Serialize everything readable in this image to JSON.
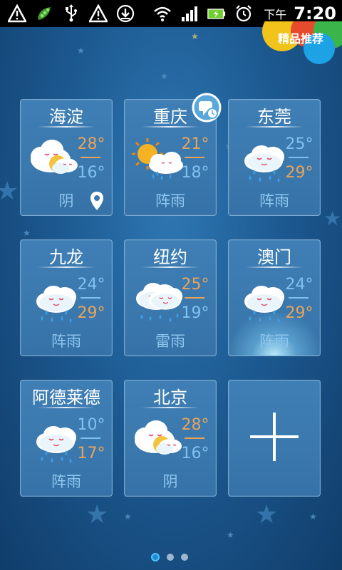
{
  "status_bar": {
    "ampm": "下午",
    "time": "7:20",
    "icons": [
      "warning-icon",
      "pea-icon",
      "usb-icon",
      "warning-icon",
      "download-icon",
      "wifi-icon",
      "signal-icon",
      "battery-icon",
      "alarm-icon"
    ]
  },
  "recommend": {
    "label": "精品推荐"
  },
  "cities": [
    {
      "name": "海淀",
      "high": "28°",
      "low": "16°",
      "condition": "阴",
      "icon": "cloudy-sun-icon",
      "located": true
    },
    {
      "name": "重庆",
      "high": "21°",
      "low": "18°",
      "condition": "阵雨",
      "icon": "sun-shower-icon",
      "clock_badge": true
    },
    {
      "name": "东莞",
      "high": "25°",
      "low": "29°",
      "condition": "阵雨",
      "icon": "rain-cloud-icon"
    },
    {
      "name": "九龙",
      "high": "24°",
      "low": "29°",
      "condition": "阵雨",
      "icon": "rain-cloud-icon"
    },
    {
      "name": "纽约",
      "high": "25°",
      "low": "19°",
      "condition": "雷雨",
      "icon": "thunderstorm-icon"
    },
    {
      "name": "澳门",
      "high": "24°",
      "low": "29°",
      "condition": "阵雨",
      "icon": "rain-cloud-icon",
      "selected": true
    },
    {
      "name": "阿德莱德",
      "high": "10°",
      "low": "17°",
      "condition": "阵雨",
      "icon": "rain-cloud-icon"
    },
    {
      "name": "北京",
      "high": "28°",
      "low": "16°",
      "condition": "阴",
      "icon": "cloudy-sun-icon"
    }
  ],
  "add_button": {
    "icon": "plus-icon"
  },
  "pager": {
    "pages": 3,
    "current": 1
  },
  "colors": {
    "temp_high": "#e8a35a",
    "temp_low_warm": "#e8a35a",
    "temp_blue": "#7fc2f0",
    "condition": "#8fc6f0"
  }
}
